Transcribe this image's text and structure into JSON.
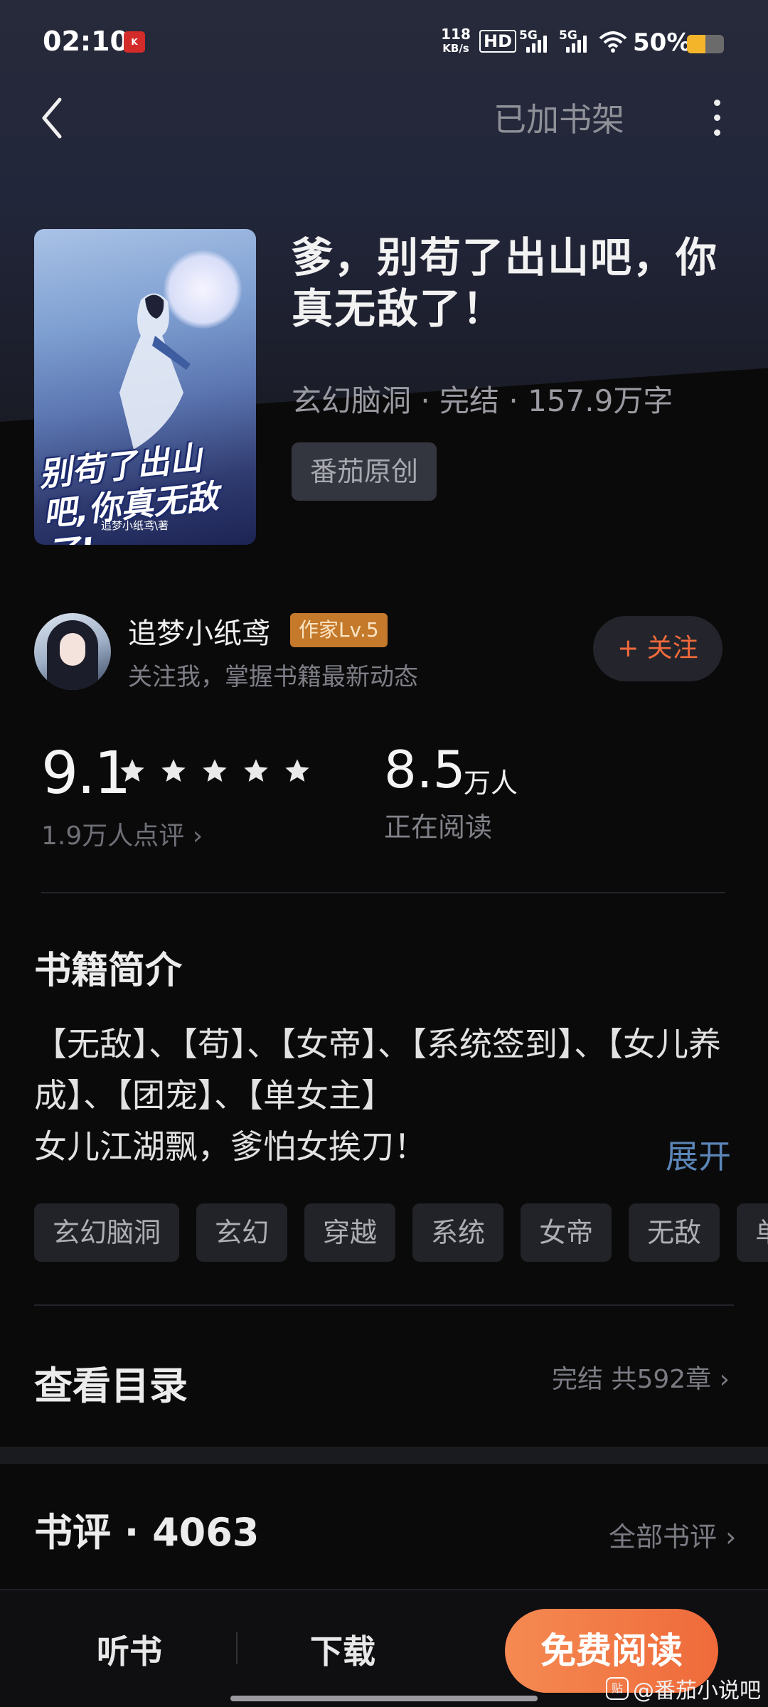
{
  "status_bar": {
    "time": "02:10",
    "net_speed_value": "118",
    "net_speed_unit": "KB/s",
    "hd_label": "HD",
    "network_1": "5G",
    "network_2": "5G",
    "battery_text": "50%",
    "battery_level": 0.5
  },
  "nav": {
    "shelf_label": "已加书架"
  },
  "book": {
    "cover_title": "别苟了出山吧,你真无敌了!",
    "title": "爹，别苟了出山吧，你真无敌了！",
    "meta": "玄幻脑洞 · 完结 · 157.9万字",
    "badge": "番茄原创"
  },
  "author": {
    "name": "追梦小纸鸢",
    "level": "作家Lv.5",
    "subtitle": "关注我，掌握书籍最新动态",
    "follow_label": "+ 关注"
  },
  "stats": {
    "rating": "9.1",
    "stars": 5,
    "reviews": "1.9万人点评 ›",
    "reading_value": "8.5",
    "reading_unit": "万人",
    "reading_label": "正在阅读"
  },
  "intro": {
    "title": "书籍简介",
    "text_line1": "【无敌】、【苟】、【女帝】、【系统签到】、【女儿养成】、【团宠】、【单女主】",
    "text_line2": "女儿江湖飘，爹怕女挨刀！",
    "expand": "展开",
    "tags": [
      "玄幻脑洞",
      "玄幻",
      "穿越",
      "系统",
      "女帝",
      "无敌",
      "单"
    ]
  },
  "catalog": {
    "title": "查看目录",
    "info": "完结 共592章 ›"
  },
  "reviews": {
    "title": "书评 · 4063",
    "all": "全部书评 ›"
  },
  "bottom_bar": {
    "listen": "听书",
    "download": "下载",
    "read": "免费阅读"
  },
  "watermark": {
    "icon": "贴",
    "text": "@番茄小说吧"
  },
  "colors": {
    "accent_orange": "#ef6a3a",
    "link_blue": "#5c86b8",
    "level_badge": "#c47a2a"
  }
}
